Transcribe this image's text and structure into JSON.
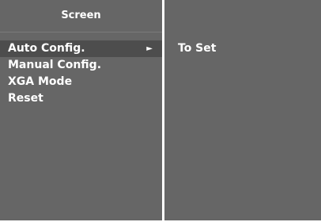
{
  "panel": {
    "title": "Screen"
  },
  "menu": {
    "items": [
      {
        "label": "Auto Config.",
        "selected": true,
        "submenu_arrow": "►"
      },
      {
        "label": "Manual Config.",
        "selected": false
      },
      {
        "label": "XGA Mode",
        "selected": false
      },
      {
        "label": "Reset",
        "selected": false
      }
    ]
  },
  "submenu": {
    "option_label": "To Set"
  },
  "colors": {
    "panel_background": "#666666",
    "selected_background": "#4d4d4d",
    "text": "#ffffff",
    "divider": "#ffffff"
  }
}
